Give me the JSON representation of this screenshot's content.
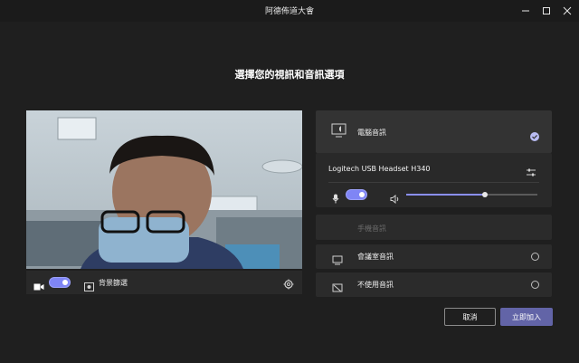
{
  "window": {
    "title": "阿德佈道大會"
  },
  "icons": {
    "minimize": "minimize-icon",
    "maximize": "maximize-icon",
    "close": "close-icon",
    "camera": "camera-icon",
    "background": "background-effects-icon",
    "settings": "gear-icon",
    "computer_audio": "computer-audio-icon",
    "check": "check-icon",
    "adjust": "sliders-icon",
    "mic": "microphone-icon",
    "speaker": "speaker-icon",
    "room": "room-audio-icon",
    "no_audio": "no-audio-icon"
  },
  "colors": {
    "accent": "#6264a7",
    "toggle": "#7f85f5",
    "background": "#1f1f1f"
  },
  "heading": "選擇您的視訊和音訊選項",
  "video_bar": {
    "camera_on": true,
    "background_label": "背景篩選"
  },
  "audio": {
    "computer_audio": {
      "label": "電腦音訊",
      "selected": true
    },
    "device": "Logitech USB Headset H340",
    "mic_on": true,
    "speaker_volume": 0.6,
    "phone_audio": {
      "label": "手機音訊"
    },
    "room_audio": {
      "label": "會議室音訊",
      "selected": false
    },
    "no_audio": {
      "label": "不使用音訊",
      "selected": false
    }
  },
  "buttons": {
    "cancel": "取消",
    "join": "立即加入"
  }
}
